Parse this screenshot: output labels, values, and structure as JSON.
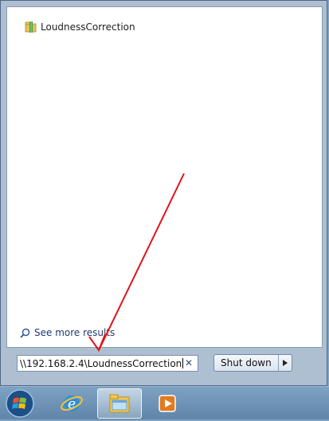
{
  "results": {
    "items": [
      {
        "label": "LoudnessCorrection",
        "icon": "folder-icon"
      }
    ],
    "see_more": "See more results"
  },
  "search": {
    "value": "\\\\192.168.2.4\\LoudnessCorrection"
  },
  "power": {
    "shutdown_label": "Shut down"
  },
  "taskbar": {
    "items": [
      "start-orb-icon",
      "internet-explorer-icon",
      "windows-explorer-icon",
      "media-player-icon"
    ]
  },
  "annotation": {
    "color": "#e0141b"
  }
}
